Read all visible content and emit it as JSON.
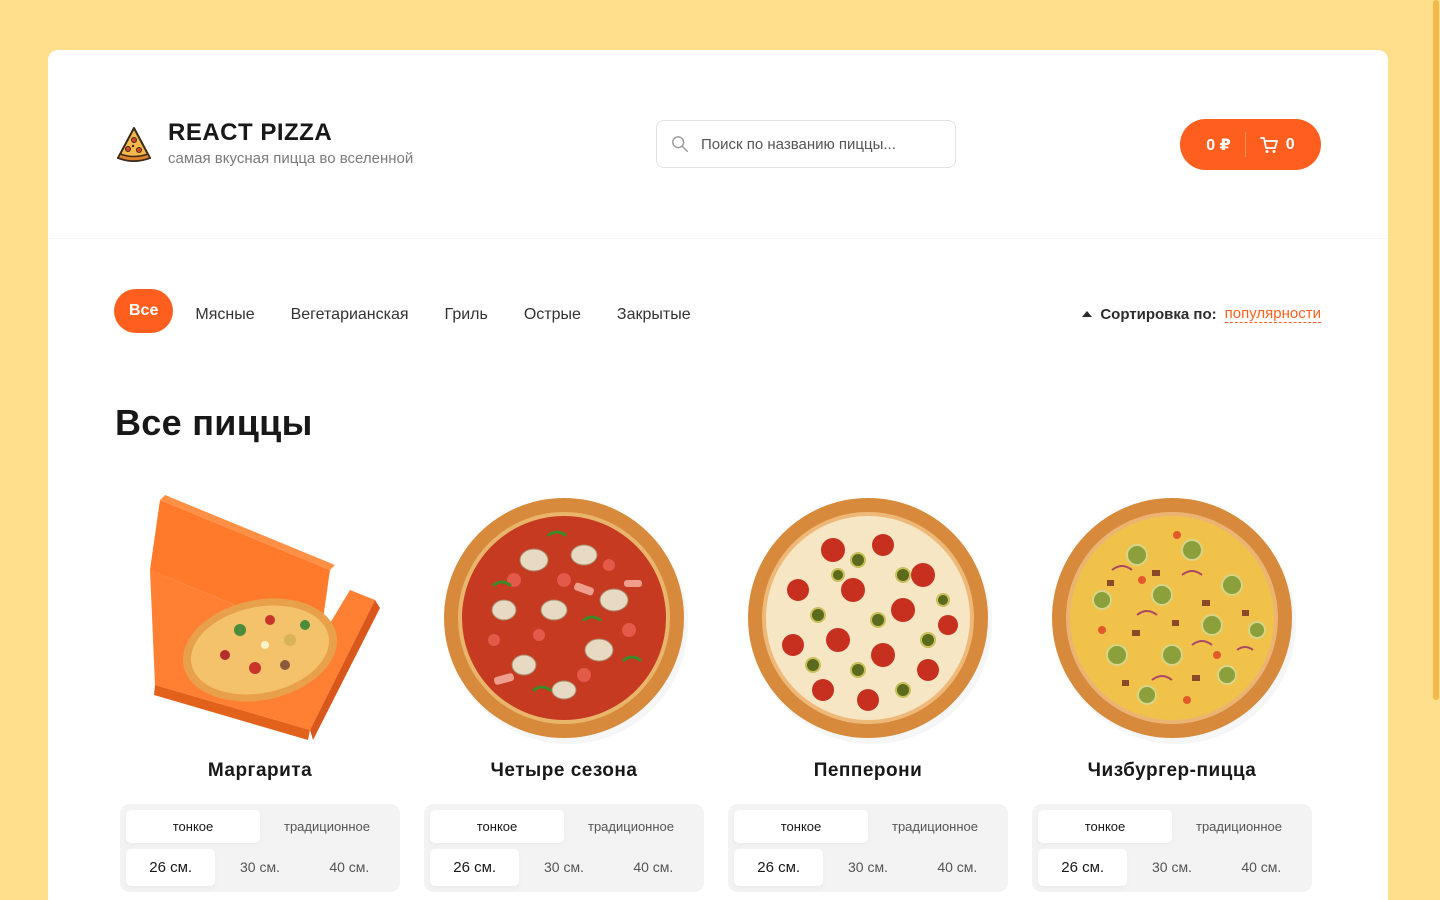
{
  "header": {
    "title": "REACT PIZZA",
    "subtitle": "самая вкусная пицца во вселенной",
    "search_placeholder": "Поиск по названию пиццы...",
    "cart_total": "0 ₽",
    "cart_count": "0"
  },
  "categories": [
    "Все",
    "Мясные",
    "Вегетарианская",
    "Гриль",
    "Острые",
    "Закрытые"
  ],
  "sort": {
    "label": "Сортировка по:",
    "value": "популярности"
  },
  "content_title": "Все пиццы",
  "pizzas": [
    {
      "title": "Маргарита",
      "types": [
        "тонкое",
        "традиционное"
      ],
      "sizes": [
        "26 см.",
        "30 см.",
        "40 см."
      ]
    },
    {
      "title": "Четыре сезона",
      "types": [
        "тонкое",
        "традиционное"
      ],
      "sizes": [
        "26 см.",
        "30 см.",
        "40 см."
      ]
    },
    {
      "title": "Пепперони",
      "types": [
        "тонкое",
        "традиционное"
      ],
      "sizes": [
        "26 см.",
        "30 см.",
        "40 см."
      ]
    },
    {
      "title": "Чизбургер-пицца",
      "types": [
        "тонкое",
        "традиционное"
      ],
      "sizes": [
        "26 см.",
        "30 см.",
        "40 см."
      ]
    }
  ],
  "colors": {
    "accent": "#fe5f1e",
    "page_bg": "#ffdf8c"
  }
}
